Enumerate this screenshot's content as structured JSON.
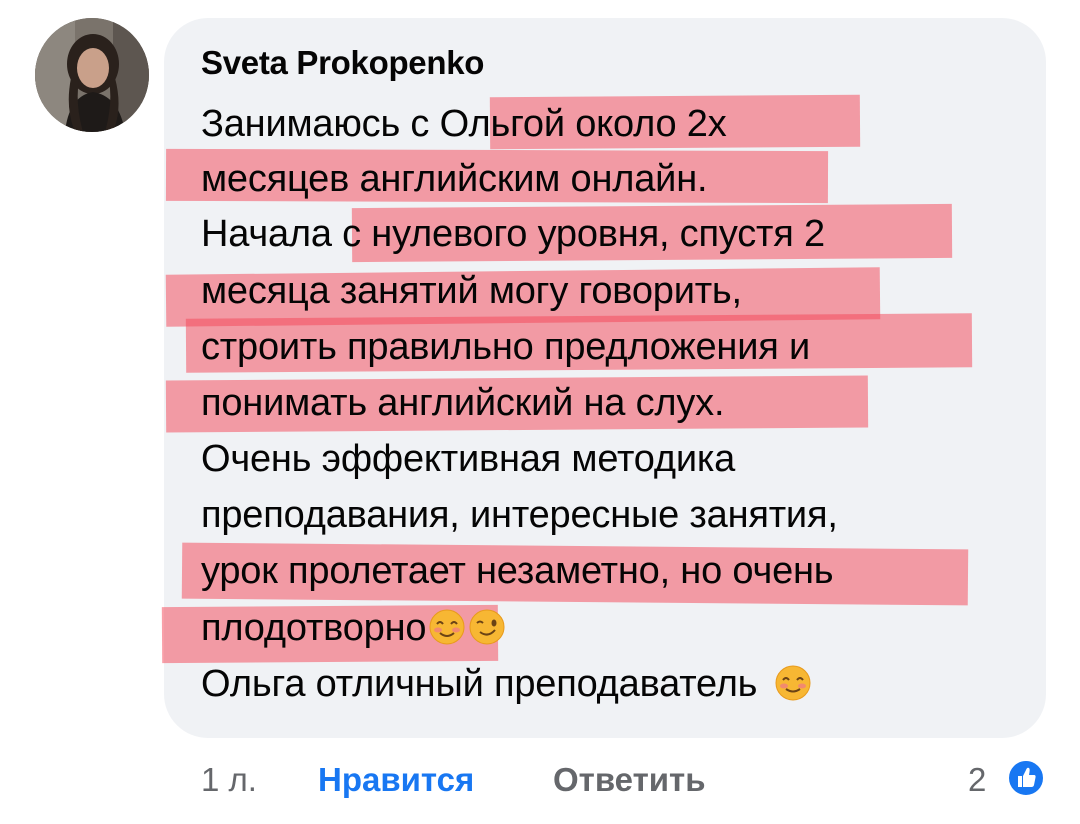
{
  "comment": {
    "author": "Sveta Prokopenko",
    "lines": [
      "Занимаюсь с Ольгой около 2х",
      "месяцев английским онлайн.",
      "Начала с нулевого уровня, спустя 2",
      "месяца занятий могу говорить,",
      "строить правильно предложения и",
      "понимать английский на слух.",
      "Очень эффективная методика",
      "преподавания, интересные занятия,",
      "урок пролетает незаметно, но очень",
      "плодотворно",
      "Ольга отличный преподаватель"
    ],
    "emoji": [
      "smiling-face-with-smiling-eyes",
      "winking-face",
      "smiling-face"
    ]
  },
  "footer": {
    "time": "1 л.",
    "like_label": "Нравится",
    "reply_label": "Ответить",
    "like_count": "2"
  },
  "colors": {
    "highlight": "#f3485a",
    "link": "#1877f2",
    "secondary_text": "#65676b",
    "bubble": "#f0f2f5"
  }
}
